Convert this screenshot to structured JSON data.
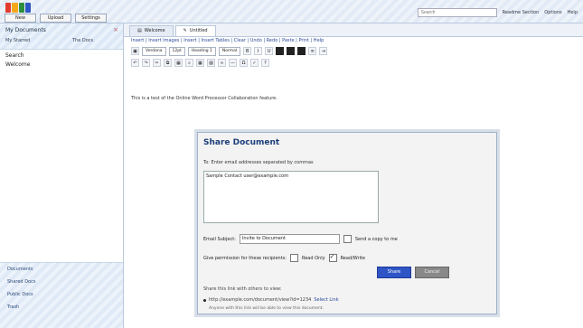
{
  "topbar": {
    "logo_colors": [
      "#e23b2e",
      "#f3a81a",
      "#2b8f3b",
      "#2a57c4"
    ],
    "new_buttons": [
      "New",
      "Upload",
      "Settings"
    ],
    "search_placeholder": "Search",
    "links": [
      "Readme Section",
      "Options",
      "Help"
    ]
  },
  "sidebar": {
    "title": "My Documents",
    "subtitle": "My Starred",
    "subtitle2": "The Docs",
    "items": [
      "Search",
      "Welcome"
    ],
    "footer": [
      "Documents",
      "Shared Docs",
      "Public Docs",
      "Trash"
    ]
  },
  "main": {
    "tabs": [
      {
        "label": "Welcome",
        "active": false
      },
      {
        "label": "Untitled",
        "active": true
      }
    ],
    "menu": "Insert | Insert Images | Insert | Insert Tables | Clear | Undo | Redo | Paste | Print | Help",
    "font_select": "Verdana",
    "size_select": "12pt",
    "style_select": "Heading 1",
    "format_select": "Normal",
    "doc_text": "This is a test of the Online Word Processor Collaboration feature."
  },
  "dialog": {
    "title": "Share Document",
    "to_label": "To:",
    "to_hint": "Enter email addresses separated by commas",
    "recipients": "Sample Contact user@example.com",
    "subject_label": "Email Subject:",
    "subject_value": "Invite to Document",
    "send_copy_label": "Send a copy to me",
    "send_copy_checked": false,
    "perm_label": "Give permission for these recipients:",
    "perm_options": [
      {
        "label": "Read Only",
        "checked": false
      },
      {
        "label": "Read/Write",
        "checked": true
      }
    ],
    "share_label": "Share",
    "cancel_label": "Cancel",
    "links_title": "Share this link with others to view:",
    "link_url": "http://example.com/document/view?id=1234",
    "link_action": "Select Link",
    "note": "Anyone with this link will be able to view this document."
  }
}
